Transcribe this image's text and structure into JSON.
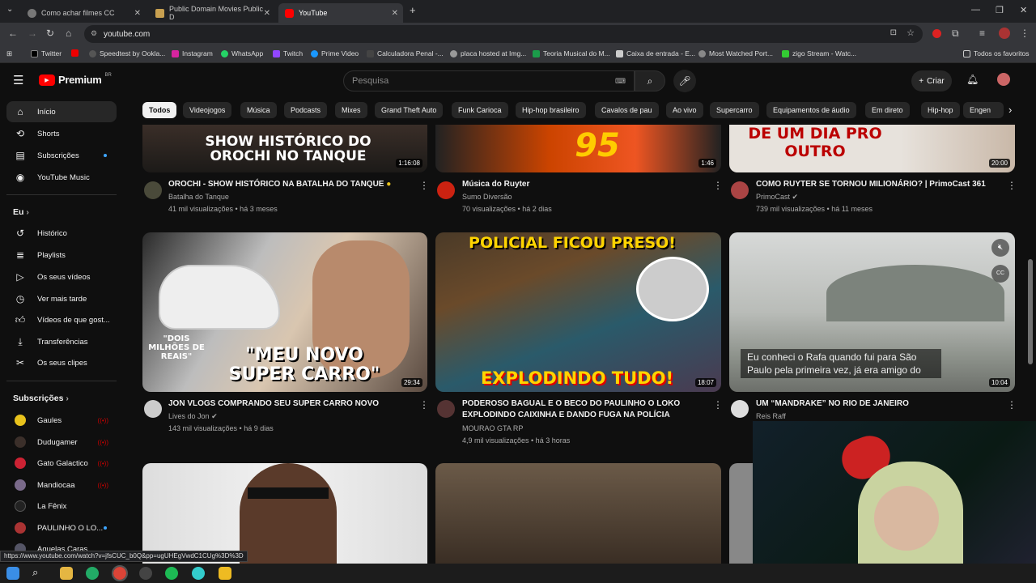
{
  "browser": {
    "tabs": [
      {
        "title": "Como achar filmes CC"
      },
      {
        "title": "Public Domain Movies Public D"
      },
      {
        "title": "YouTube"
      }
    ],
    "url": "youtube.com",
    "bookmarks": [
      "Twitter",
      "Speedtest by Ookla...",
      "Instagram",
      "WhatsApp",
      "Twitch",
      "Prime Video",
      "Calculadora Penal -...",
      "placa hosted at Img...",
      "Teoria Musical do M...",
      "Caixa de entrada - E...",
      "Most Watched Port...",
      "zigo Stream - Watc...",
      "Todos os favoritos"
    ],
    "status_url": "https://www.youtube.com/watch?v=jfsCUC_b0Q&pp=ugUHEgVwdC1CUg%3D%3D"
  },
  "header": {
    "logo": "Premium",
    "region": "BR",
    "search_placeholder": "Pesquisa",
    "create_label": "Criar"
  },
  "sidebar": {
    "main": [
      "Início",
      "Shorts",
      "Subscrições",
      "YouTube Music"
    ],
    "you_heading": "Eu",
    "you": [
      "Histórico",
      "Playlists",
      "Os seus vídeos",
      "Ver mais tarde",
      "Vídeos de que gost...",
      "Transferências",
      "Os seus clipes"
    ],
    "subs_heading": "Subscrições",
    "subs": [
      "Gaules",
      "Dudugamer",
      "Gato Galactico",
      "Mandiocaa",
      "La Fênix",
      "PAULINHO O LO...",
      "Aquelas Caras"
    ]
  },
  "chips": [
    "Todos",
    "Videojogos",
    "Música",
    "Podcasts",
    "Mixes",
    "Grand Theft Auto",
    "Funk Carioca",
    "Hip-hop brasileiro",
    "Cavalos de pau",
    "Ao vivo",
    "Supercarro",
    "Equipamentos de áudio",
    "Em direto",
    "Hip-hop",
    "Engen"
  ],
  "videos": [
    {
      "title": "OROCHI - SHOW HISTÓRICO NA BATALHA DO TANQUE",
      "channel": "Batalha do Tanque",
      "meta": "41 mil visualizações • há 3 meses",
      "duration": "1:16:08",
      "thumb_text": "SHOW HISTÓRICO DO OROCHI NO TANQUE"
    },
    {
      "title": "Música do Ruyter",
      "channel": "Sumo Diversão",
      "meta": "70 visualizações • há 2 dias",
      "duration": "1:46",
      "thumb_text": "95"
    },
    {
      "title": "COMO RUYTER SE TORNOU MILIONÁRIO? | PrimoCast 361",
      "channel": "PrimoCast",
      "meta": "739 mil visualizações • há 11 meses",
      "duration": "20:00",
      "thumb_text": "DE UM DIA PRO OUTRO"
    },
    {
      "title": "JON VLOGS COMPRANDO SEU SUPER CARRO NOVO",
      "channel": "Lives do Jon",
      "meta": "143 mil visualizações • há 9 dias",
      "duration": "29:34",
      "thumb_text": "\"MEU NOVO SUPER CARRO\"",
      "thumb_text2": "\"DOIS MILHÕES DE REAIS\""
    },
    {
      "title": "PODEROSO BAGUAL E O BECO DO PAULINHO O LOKO EXPLODINDO CAIXINHA E DANDO FUGA NA POLÍCIA",
      "channel": "MOURAO GTA RP",
      "meta": "4,9 mil visualizações • há 3 horas",
      "duration": "18:07",
      "thumb_text": "POLICIAL FICOU PRESO!",
      "thumb_text2": "EXPLODINDO TUDO!"
    },
    {
      "title": "UM “MANDRAKE” NO RIO DE JANEIRO",
      "channel": "Reis Raff",
      "meta": "",
      "duration": "10:04",
      "caption": "Eu conheci o Rafa quando fui para São Paulo pela primeira vez, já era amigo do"
    }
  ]
}
